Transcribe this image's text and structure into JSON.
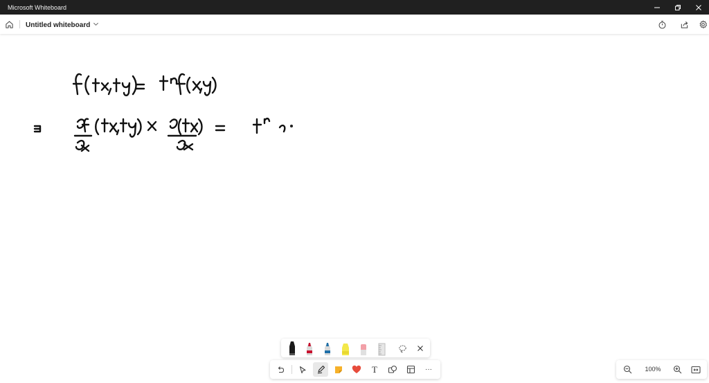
{
  "window": {
    "app_title": "Microsoft Whiteboard",
    "minimize_icon": "minimize-icon",
    "restore_icon": "restore-icon",
    "close_icon": "close-icon"
  },
  "header": {
    "board_title": "Untitled whiteboard",
    "home_icon": "home-icon",
    "title_menu_icon": "chevron-down-icon",
    "timer_icon": "timer-icon",
    "share_icon": "share-icon",
    "settings_icon": "gear-icon"
  },
  "pen_tray": {
    "pens": [
      {
        "name": "black-pen",
        "color": "#1a1a1a"
      },
      {
        "name": "red-pen",
        "color": "#c8102e"
      },
      {
        "name": "blue-pen",
        "color": "#1e6fa8"
      },
      {
        "name": "yellow-highlighter",
        "color": "#f3e84a"
      },
      {
        "name": "pink-eraser",
        "color": "#f2a0a8"
      },
      {
        "name": "ruler",
        "color": "#bdbdbd"
      }
    ],
    "lasso_icon": "lasso-icon",
    "close_icon": "close-icon"
  },
  "main_toolbar": {
    "undo_icon": "undo-icon",
    "select_icon": "pointer-icon",
    "ink_icon": "pen-icon",
    "note_icon": "sticky-note-icon",
    "reaction_icon": "heart-icon",
    "text_label": "T",
    "shapes_icon": "shapes-icon",
    "templates_icon": "templates-icon",
    "more_label": "···"
  },
  "zoom": {
    "zoom_out_icon": "zoom-out-icon",
    "level": "100%",
    "zoom_in_icon": "zoom-in-icon",
    "fit_icon": "fit-screen-icon"
  },
  "accent": {
    "heart": "#e74c3c",
    "note": "#f6b12a"
  }
}
